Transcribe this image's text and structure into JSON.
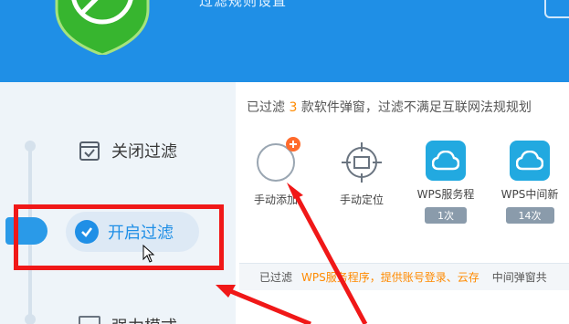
{
  "header": {
    "title": "过滤规则设置",
    "logo_icon": "shield-check-icon"
  },
  "sidebar": {
    "items": [
      {
        "label": "关闭过滤",
        "icon": "document-check-icon",
        "selected": false
      },
      {
        "label": "开启过滤",
        "icon": "check-circle-icon",
        "selected": true
      },
      {
        "label": "强力模式",
        "icon": "window-icon",
        "selected": false
      }
    ]
  },
  "info": {
    "prefix": "已过滤",
    "count": "3",
    "suffix": "款软件弹窗，过滤不满足互联网法规规划"
  },
  "grid": {
    "items": [
      {
        "label": "手动添加",
        "icon": "add-circle-icon",
        "badge": ""
      },
      {
        "label": "手动定位",
        "icon": "crosshair-icon",
        "badge": ""
      },
      {
        "label": "WPS服务程",
        "icon": "cloud-icon",
        "badge": "1次"
      },
      {
        "label": "WPS中间新",
        "icon": "cloud-icon",
        "badge": "14次"
      }
    ]
  },
  "bottom_bar": {
    "label": "已过滤",
    "apps": "WPS服务程序，提供账号登录、云存",
    "mid": "中间弹窗共"
  },
  "colors": {
    "header_bg": "#1f8fe6",
    "accent": "#1f8fe6",
    "highlight": "#ff8a00",
    "annotation": "#f01818"
  }
}
